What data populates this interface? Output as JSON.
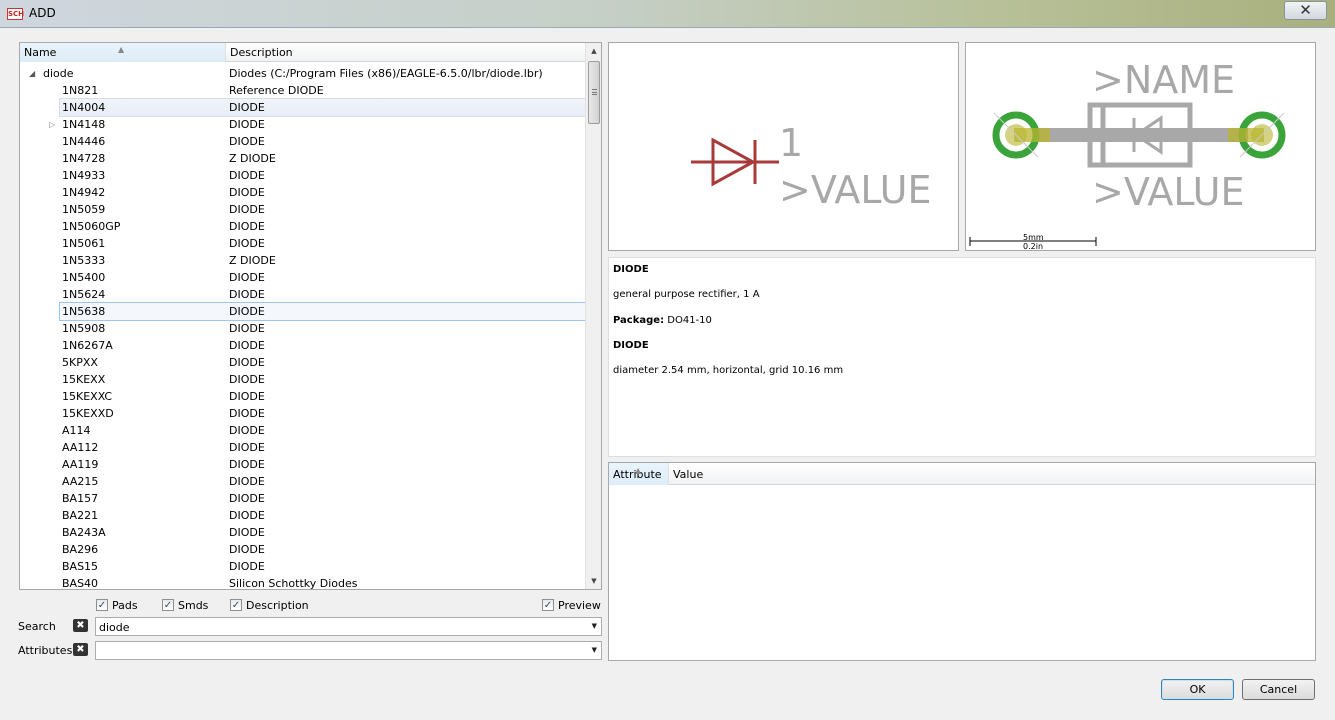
{
  "window": {
    "title": "ADD",
    "app_icon_text": "SCH",
    "close_symbol": "✕"
  },
  "tree": {
    "columns": {
      "name": "Name",
      "description": "Description"
    },
    "parent": {
      "name": "diode",
      "description": "Diodes (C:/Program Files (x86)/EAGLE-6.5.0/lbr/diode.lbr)"
    },
    "rows": [
      {
        "name": "1N821",
        "description": "Reference DIODE"
      },
      {
        "name": "1N4004",
        "description": "DIODE"
      },
      {
        "name": "1N4148",
        "description": "DIODE"
      },
      {
        "name": "1N4446",
        "description": "DIODE"
      },
      {
        "name": "1N4728",
        "description": "Z DIODE"
      },
      {
        "name": "1N4933",
        "description": "DIODE"
      },
      {
        "name": "1N4942",
        "description": "DIODE"
      },
      {
        "name": "1N5059",
        "description": "DIODE"
      },
      {
        "name": "1N5060GP",
        "description": "DIODE"
      },
      {
        "name": "1N5061",
        "description": "DIODE"
      },
      {
        "name": "1N5333",
        "description": "Z DIODE"
      },
      {
        "name": "1N5400",
        "description": "DIODE"
      },
      {
        "name": "1N5624",
        "description": "DIODE"
      },
      {
        "name": "1N5638",
        "description": "DIODE"
      },
      {
        "name": "1N5908",
        "description": "DIODE"
      },
      {
        "name": "1N6267A",
        "description": "DIODE"
      },
      {
        "name": "5KPXX",
        "description": "DIODE"
      },
      {
        "name": "15KEXX",
        "description": "DIODE"
      },
      {
        "name": "15KEXXC",
        "description": "DIODE"
      },
      {
        "name": "15KEXXD",
        "description": "DIODE"
      },
      {
        "name": "A114",
        "description": "DIODE"
      },
      {
        "name": "AA112",
        "description": "DIODE"
      },
      {
        "name": "AA119",
        "description": "DIODE"
      },
      {
        "name": "AA215",
        "description": "DIODE"
      },
      {
        "name": "BA157",
        "description": "DIODE"
      },
      {
        "name": "BA221",
        "description": "DIODE"
      },
      {
        "name": "BA243A",
        "description": "DIODE"
      },
      {
        "name": "BA296",
        "description": "DIODE"
      },
      {
        "name": "BAS15",
        "description": "DIODE"
      },
      {
        "name": "BAS40",
        "description": "Silicon Schottky Diodes"
      }
    ],
    "selected_name": "1N4004",
    "hovered_name": "1N5638"
  },
  "filters": {
    "pads": {
      "label": "Pads",
      "checked": true
    },
    "smds": {
      "label": "Smds",
      "checked": true
    },
    "description": {
      "label": "Description",
      "checked": true
    },
    "preview": {
      "label": "Preview",
      "checked": true
    }
  },
  "search": {
    "label": "Search",
    "value": "diode"
  },
  "attributes_filter": {
    "label": "Attributes",
    "value": ""
  },
  "symbol_preview": {
    "pin_number": "1",
    "value_text": ">VALUE",
    "symbol_color": "#a83a3a"
  },
  "package_preview": {
    "name_text": ">NAME",
    "value_text": ">VALUE",
    "scale_top": "5mm",
    "scale_bottom": "0.2in",
    "pad_color": "#3aa43a"
  },
  "details": {
    "heading1": "DIODE",
    "line1": "general purpose rectifier, 1 A",
    "package_label": "Package:",
    "package_value": "DO41-10",
    "heading2": "DIODE",
    "line2": "diameter 2.54 mm, horizontal, grid 10.16 mm"
  },
  "attribute_table": {
    "col_attribute": "Attribute",
    "col_value": "Value"
  },
  "buttons": {
    "ok": "OK",
    "cancel": "Cancel"
  }
}
